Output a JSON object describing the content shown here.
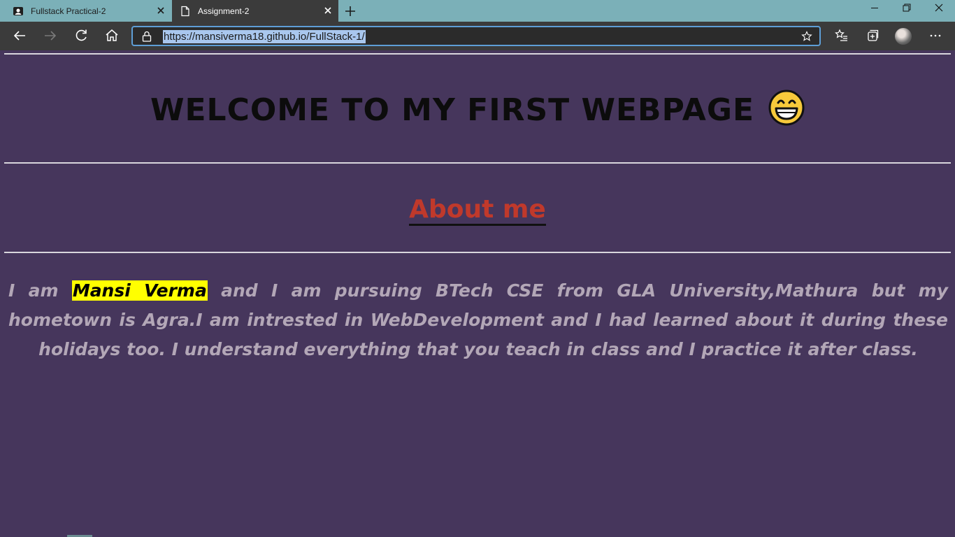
{
  "browser": {
    "tabs": [
      {
        "title": "Fullstack Practical-2",
        "active": false
      },
      {
        "title": "Assignment-2",
        "active": true
      }
    ],
    "address": {
      "url": "https://mansiverma18.github.io/FullStack-1/"
    },
    "colors": {
      "tabstrip": "#7bb0b8",
      "toolbar": "#3b3b3b",
      "address_border": "#5e9ed6",
      "url_highlight": "#a9c7ee"
    }
  },
  "page": {
    "heading": "WELCOME TO MY FIRST WEBPAGE",
    "heading_emoji": "grinning-face-emoji",
    "about_title": "About me",
    "para_before": "I am ",
    "para_highlight": "Mansi Verma",
    "para_after": " and I am pursuing BTech CSE from GLA University,Mathura but my hometown is Agra.I am intrested in WebDevelopment and I had learned about it during these holidays too. I understand everything that you teach in class and I practice it after class.",
    "colors": {
      "background": "#46365c",
      "heading": "#0c0c0c",
      "about": "#c0392b",
      "paragraph": "#b3a7b7",
      "highlight": "#ffff00"
    }
  }
}
